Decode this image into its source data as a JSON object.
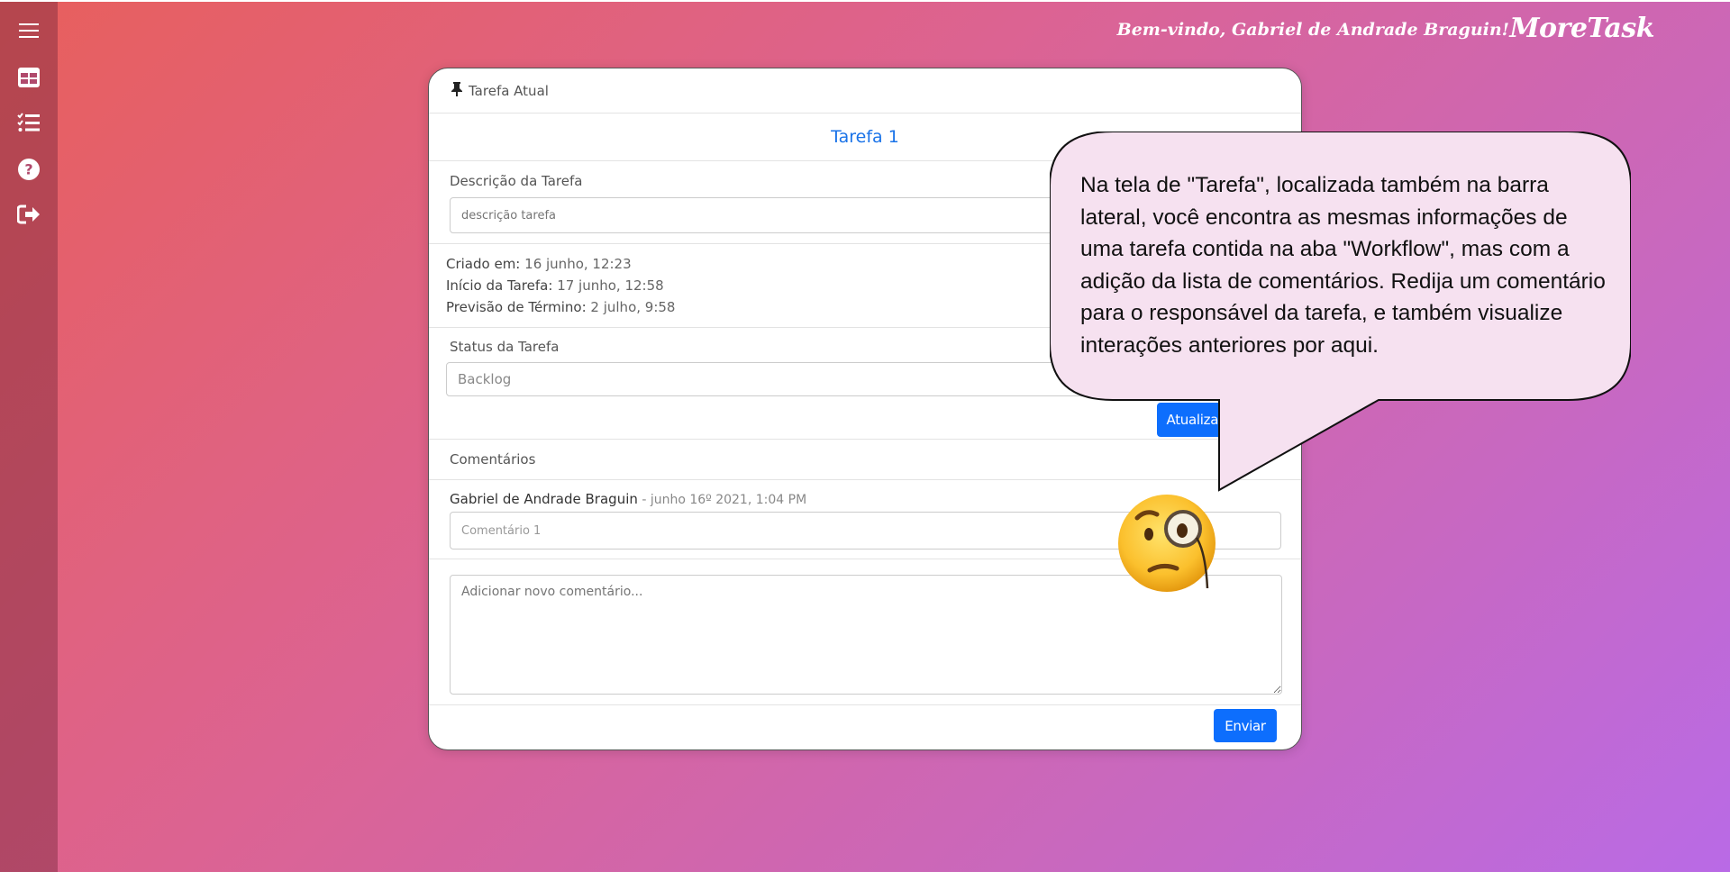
{
  "header": {
    "welcome": "Bem-vindo, Gabriel de Andrade Braguin!",
    "brand": "MoreTask"
  },
  "sidebar": {
    "items": [
      {
        "icon": "menu-icon"
      },
      {
        "icon": "dashboard-table-icon"
      },
      {
        "icon": "task-list-icon"
      },
      {
        "icon": "help-icon"
      },
      {
        "icon": "logout-icon"
      }
    ]
  },
  "card": {
    "header": "Tarefa Atual",
    "task_title": "Tarefa 1",
    "description_label": "Descrição da Tarefa",
    "description_placeholder": "descrição tarefa",
    "dates": [
      {
        "label": "Criado em:",
        "value": "16 junho, 12:23"
      },
      {
        "label": "Início da Tarefa:",
        "value": "17 junho, 12:58"
      },
      {
        "label": "Previsão de Término:",
        "value": "2 julho, 9:58"
      }
    ],
    "status_label": "Status da Tarefa",
    "status_value": "Backlog",
    "update_status_button": "Atualizar Status",
    "comments_label": "Comentários",
    "comments": [
      {
        "author": "Gabriel de Andrade Braguin",
        "meta": " - junho 16º 2021, 1:04 PM",
        "text": "Comentário 1"
      }
    ],
    "new_comment_placeholder": "Adicionar novo comentário...",
    "send_button": "Enviar"
  },
  "callout": {
    "text": "Na tela de \"Tarefa\", localizada também na barra lateral, você encontra as mesmas informações de uma tarefa contida na aba \"Workflow\", mas com a adição da lista de comentários. Redija um comentário para o responsável da tarefa, e também visualize interações anteriores por aqui."
  },
  "colors": {
    "accent": "#0d6efd",
    "title_blue": "#1a73e8"
  }
}
